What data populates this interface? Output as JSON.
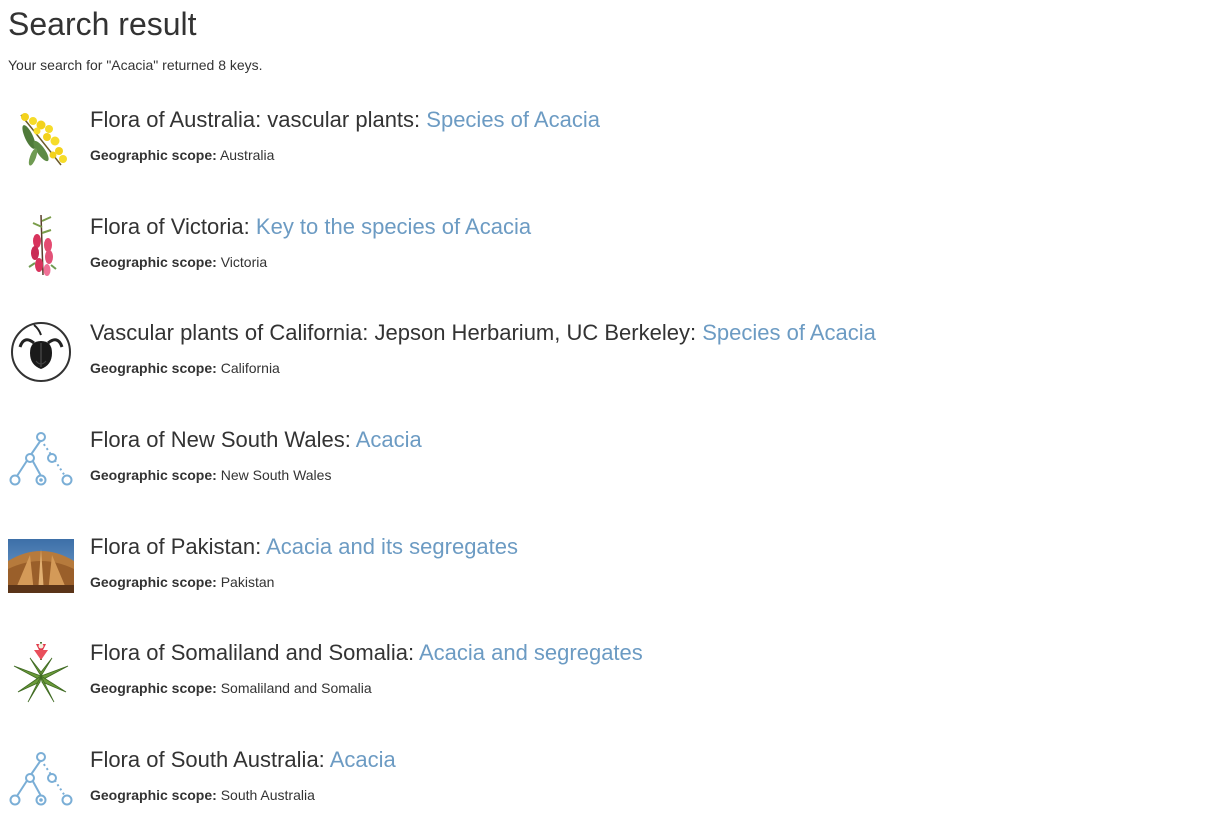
{
  "page": {
    "title": "Search result",
    "summary": "Your search for \"Acacia\" returned 8 keys."
  },
  "scope_label": "Geographic scope:",
  "colors": {
    "link": "#6c9bc3",
    "text": "#333333",
    "tree_icon": "#7aaed6"
  },
  "results": [
    {
      "prefix": "Flora of Australia: vascular plants:",
      "link": "Species of Acacia",
      "scope": "Australia",
      "icon": "wattle-flower-icon"
    },
    {
      "prefix": "Flora of Victoria:",
      "link": "Key to the species of Acacia",
      "scope": "Victoria",
      "icon": "epacris-flower-icon"
    },
    {
      "prefix": "Vascular plants of California: Jepson Herbarium, UC Berkeley:",
      "link": "Species of Acacia",
      "scope": "California",
      "icon": "jepson-logo-icon"
    },
    {
      "prefix": "Flora of New South Wales:",
      "link": "Acacia",
      "scope": "New South Wales",
      "icon": "key-tree-icon"
    },
    {
      "prefix": "Flora of Pakistan:",
      "link": "Acacia and its segregates",
      "scope": "Pakistan",
      "icon": "pakistan-monument-icon"
    },
    {
      "prefix": "Flora of Somaliland and Somalia:",
      "link": "Acacia and segregates",
      "scope": "Somaliland and Somalia",
      "icon": "aloe-plant-icon"
    },
    {
      "prefix": "Flora of South Australia:",
      "link": "Acacia",
      "scope": "South Australia",
      "icon": "key-tree-icon"
    }
  ]
}
